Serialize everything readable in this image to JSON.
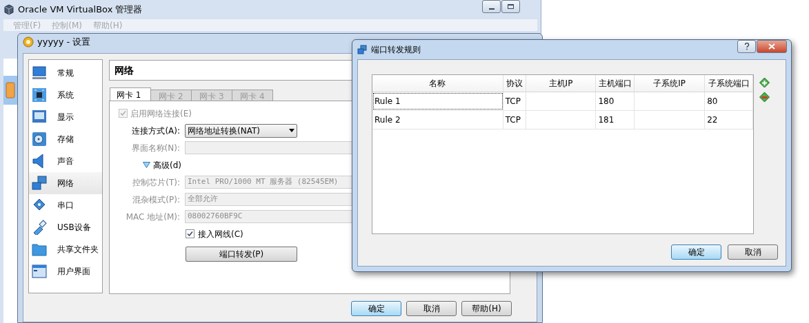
{
  "manager_window": {
    "title": "Oracle VM VirtualBox 管理器",
    "menu": [
      {
        "label": "管理(F)",
        "disabled": true
      },
      {
        "label": "控制(M)",
        "disabled": true
      },
      {
        "label": "帮助(H)",
        "disabled": true
      }
    ]
  },
  "settings_window": {
    "title": "yyyyy - 设置",
    "sidebar": [
      {
        "label": "常规",
        "selected": false
      },
      {
        "label": "系统",
        "selected": false
      },
      {
        "label": "显示",
        "selected": false
      },
      {
        "label": "存储",
        "selected": false
      },
      {
        "label": "声音",
        "selected": false
      },
      {
        "label": "网络",
        "selected": true
      },
      {
        "label": "串口",
        "selected": false
      },
      {
        "label": "USB设备",
        "selected": false
      },
      {
        "label": "共享文件夹",
        "selected": false
      },
      {
        "label": "用户界面",
        "selected": false
      }
    ],
    "page_title": "网络",
    "tabs": [
      {
        "label": "网卡 1",
        "selected": true
      },
      {
        "label": "网卡 2",
        "selected": false
      },
      {
        "label": "网卡 3",
        "selected": false
      },
      {
        "label": "网卡 4",
        "selected": false
      }
    ],
    "rows": [
      {
        "kind": "checkbox",
        "label": "启用网络连接(E)",
        "checked": true,
        "disabled": true
      },
      {
        "kind": "select",
        "label": "连接方式(A):",
        "value": "网络地址转换(NAT)",
        "disabled": false
      },
      {
        "kind": "text",
        "label": "界面名称(N):",
        "disabled": true
      },
      {
        "kind": "expander",
        "label": "高级(d)",
        "expanded": true
      },
      {
        "kind": "text",
        "label": "控制芯片(T):",
        "value": "Intel PRO/1000 MT 服务器 (82545EM)",
        "disabled": true
      },
      {
        "kind": "text",
        "label": "混杂模式(P):",
        "value": "全部允许",
        "disabled": true
      },
      {
        "kind": "text",
        "label": "MAC 地址(M):",
        "value": "08002760BF9C",
        "disabled": true
      },
      {
        "kind": "checkbox_field",
        "label": "接入网线(C)",
        "checked": true,
        "disabled": false
      },
      {
        "kind": "button",
        "label": "端口转发(P)"
      }
    ],
    "buttons": [
      {
        "label": "确定",
        "default": true
      },
      {
        "label": "取消",
        "default": false
      },
      {
        "label": "帮助(H)",
        "default": false
      }
    ]
  },
  "port_forwarding_dialog": {
    "title": "端口转发规则",
    "table": {
      "columns": [
        "名称",
        "协议",
        "主机IP",
        "主机端口",
        "子系统IP",
        "子系统端口"
      ],
      "rows": [
        {
          "cells": [
            "Rule 1",
            "TCP",
            null,
            "180",
            null,
            "80"
          ],
          "focused": true
        },
        {
          "cells": [
            "Rule 2",
            "TCP",
            null,
            "181",
            null,
            "22"
          ],
          "focused": false
        }
      ]
    },
    "buttons": [
      {
        "label": "确定",
        "default": true
      },
      {
        "label": "取消",
        "default": false
      }
    ]
  }
}
